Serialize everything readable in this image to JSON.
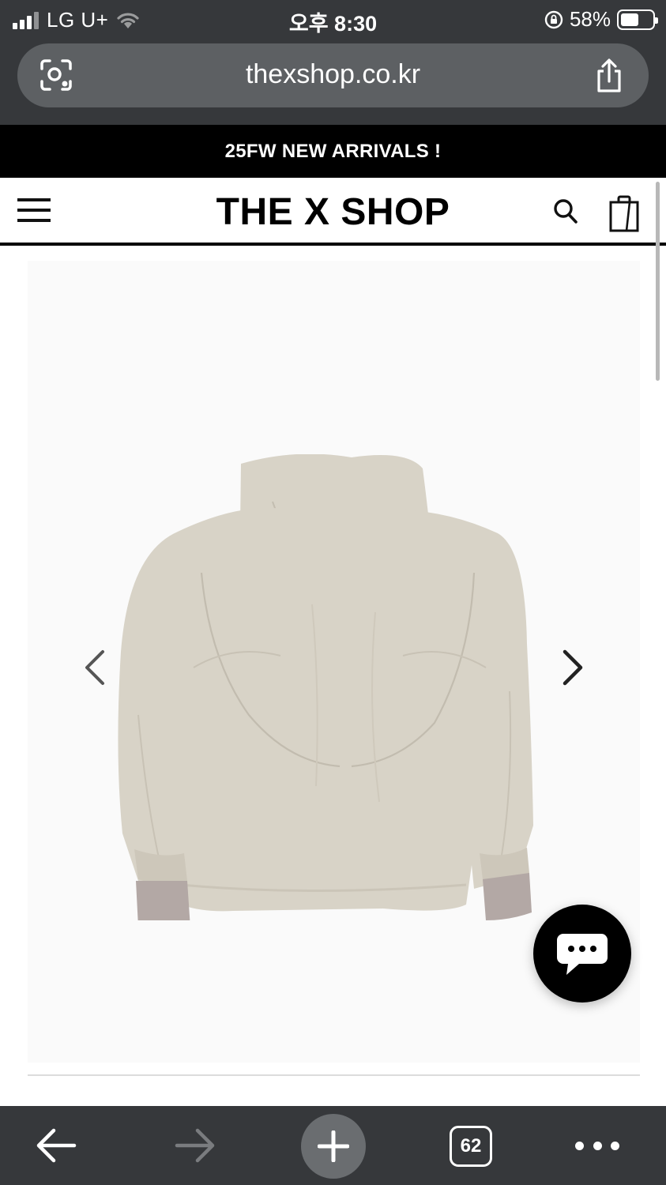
{
  "status_bar": {
    "carrier": "LG U+",
    "time": "오후 8:30",
    "battery_percent": "58%",
    "battery_level": 0.58
  },
  "browser": {
    "url": "thexshop.co.kr",
    "open_tabs": "62"
  },
  "site": {
    "announcement": "25FW NEW ARRIVALS !",
    "logo": "THE X SHOP"
  },
  "product": {
    "image_description_icon": "hooded-jacket-back-view",
    "image_color": "#d8d3c7"
  },
  "icons": {
    "scan": "scan-icon",
    "share": "share-icon",
    "menu": "hamburger-menu-icon",
    "search": "search-icon",
    "cart": "shopping-bag-icon",
    "prev": "chevron-left-icon",
    "next": "chevron-right-icon",
    "chat": "chat-bubble-icon",
    "back": "arrow-left-icon",
    "forward": "arrow-right-icon",
    "new_tab": "plus-icon",
    "more": "more-icon"
  },
  "colors": {
    "chrome": "#36383b",
    "url_bar": "#5d6063",
    "announcement_bg": "#000000",
    "accent": "#000000"
  }
}
